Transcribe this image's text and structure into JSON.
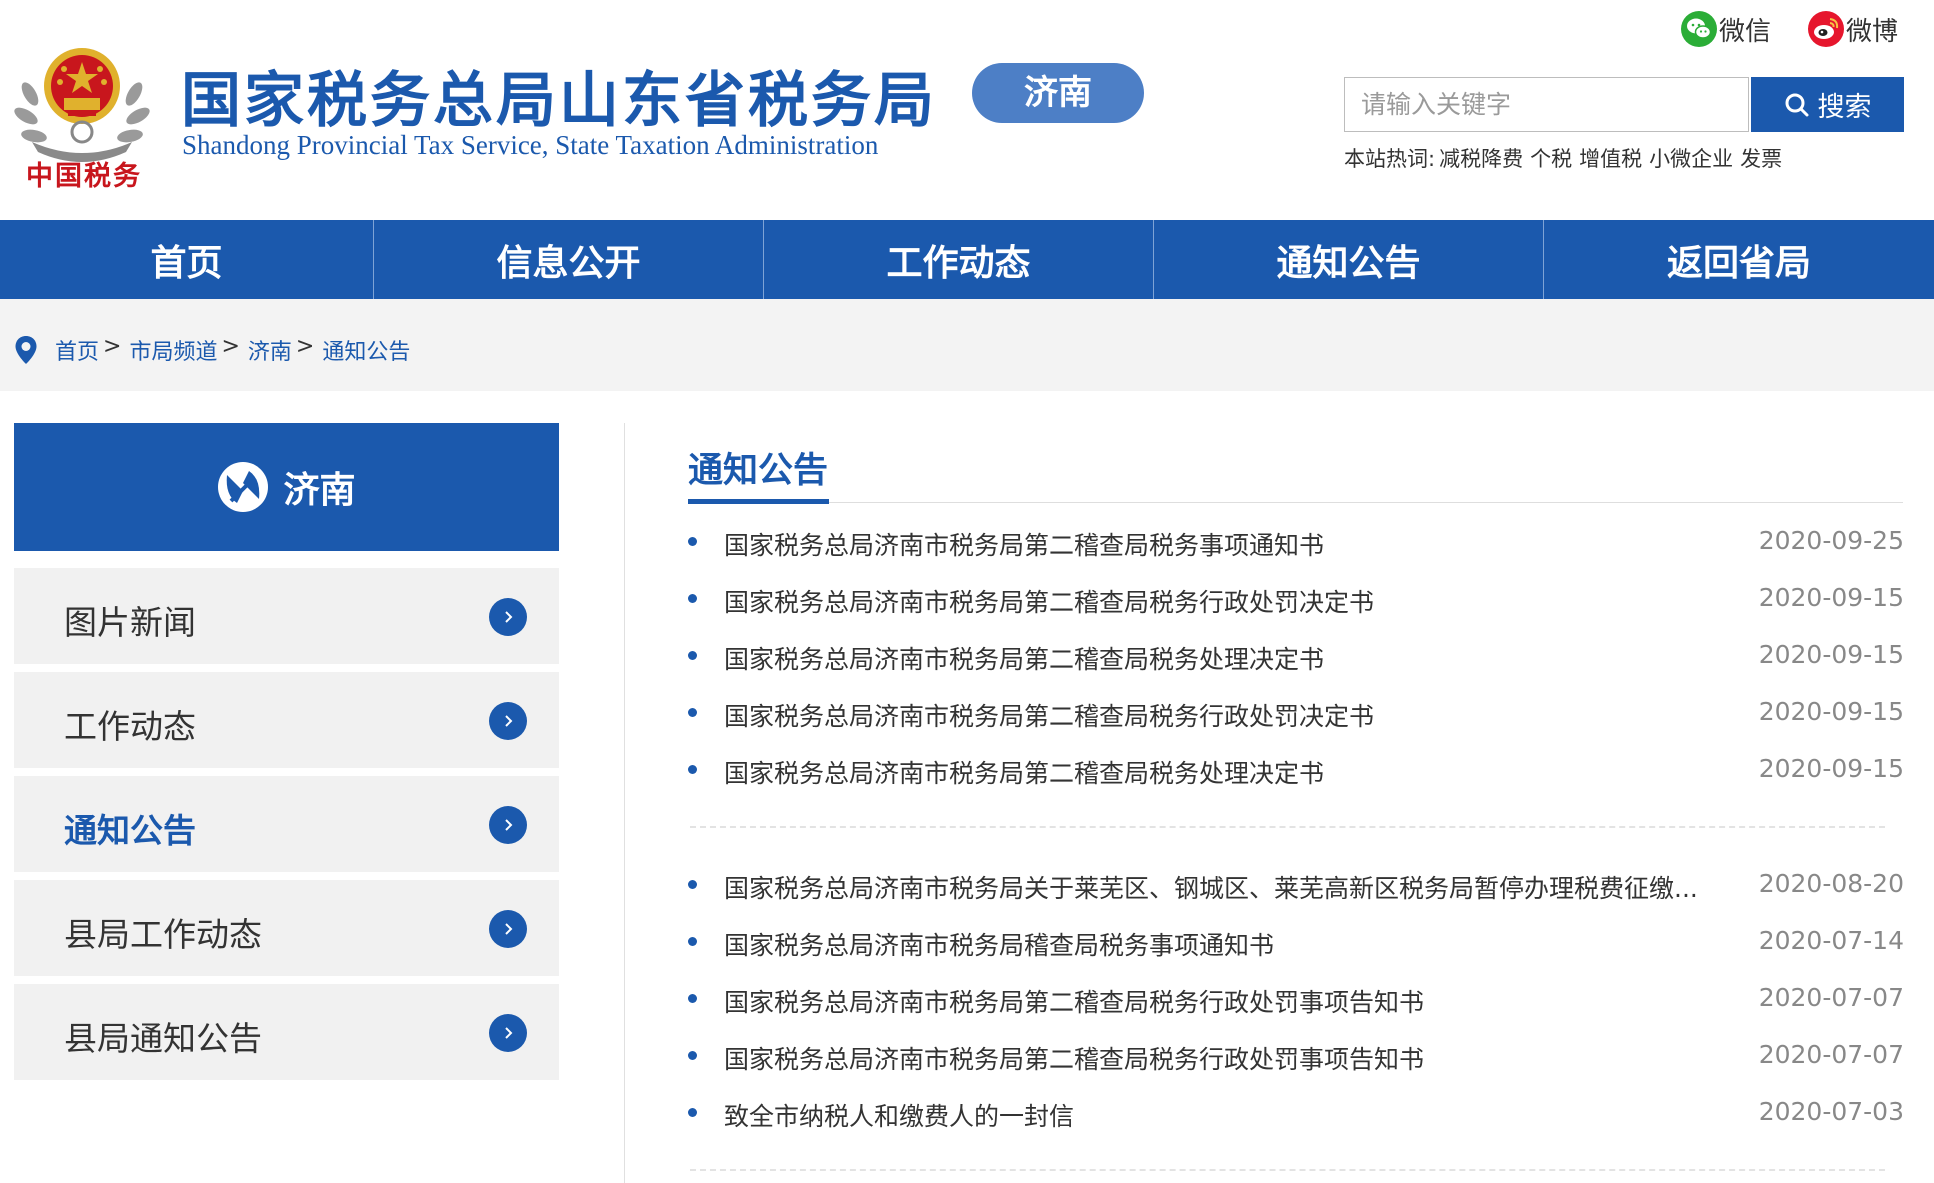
{
  "header": {
    "title_cn": "国家税务总局山东省税务局",
    "title_en": "Shandong Provincial Tax Service, State Taxation Administration",
    "emblem_caption": "中国税务",
    "city_badge": "济南",
    "social": [
      {
        "label": "微信",
        "icon": "wechat-icon",
        "color": "#2bad37"
      },
      {
        "label": "微博",
        "icon": "weibo-icon",
        "color": "#e6162d"
      }
    ],
    "search": {
      "placeholder": "请输入关键字",
      "button": "搜索"
    },
    "hot": {
      "label": "本站热词:",
      "words": [
        "减税降费",
        "个税",
        "增值税",
        "小微企业",
        "发票"
      ]
    }
  },
  "nav": {
    "items": [
      "首页",
      "信息公开",
      "工作动态",
      "通知公告",
      "返回省局"
    ]
  },
  "breadcrumb": {
    "items": [
      "首页",
      "市局频道",
      "济南",
      "通知公告"
    ],
    "separator": ">"
  },
  "sidebar": {
    "title": "济南",
    "items": [
      {
        "label": "图片新闻",
        "active": false
      },
      {
        "label": "工作动态",
        "active": false
      },
      {
        "label": "通知公告",
        "active": true
      },
      {
        "label": "县局工作动态",
        "active": false
      },
      {
        "label": "县局通知公告",
        "active": false
      }
    ]
  },
  "main": {
    "section_title": "通知公告",
    "groups": [
      [
        {
          "title": "国家税务总局济南市税务局第二稽查局税务事项通知书",
          "date": "2020-09-25"
        },
        {
          "title": "国家税务总局济南市税务局第二稽查局税务行政处罚决定书",
          "date": "2020-09-15"
        },
        {
          "title": "国家税务总局济南市税务局第二稽查局税务处理决定书",
          "date": "2020-09-15"
        },
        {
          "title": "国家税务总局济南市税务局第二稽查局税务行政处罚决定书",
          "date": "2020-09-15"
        },
        {
          "title": "国家税务总局济南市税务局第二稽查局税务处理决定书",
          "date": "2020-09-15"
        }
      ],
      [
        {
          "title": "国家税务总局济南市税务局关于莱芜区、钢城区、莱芜高新区税务局暂停办理税费征缴...",
          "date": "2020-08-20"
        },
        {
          "title": "国家税务总局济南市税务局稽查局税务事项通知书",
          "date": "2020-07-14"
        },
        {
          "title": "国家税务总局济南市税务局第二稽查局税务行政处罚事项告知书",
          "date": "2020-07-07"
        },
        {
          "title": "国家税务总局济南市税务局第二稽查局税务行政处罚事项告知书",
          "date": "2020-07-07"
        },
        {
          "title": "致全市纳税人和缴费人的一封信",
          "date": "2020-07-03"
        }
      ]
    ]
  },
  "colors": {
    "brand_blue": "#1b59ad",
    "badge_blue": "#4d7fc6",
    "emblem_red": "#c8161d",
    "emblem_gold": "#e0b12d"
  }
}
